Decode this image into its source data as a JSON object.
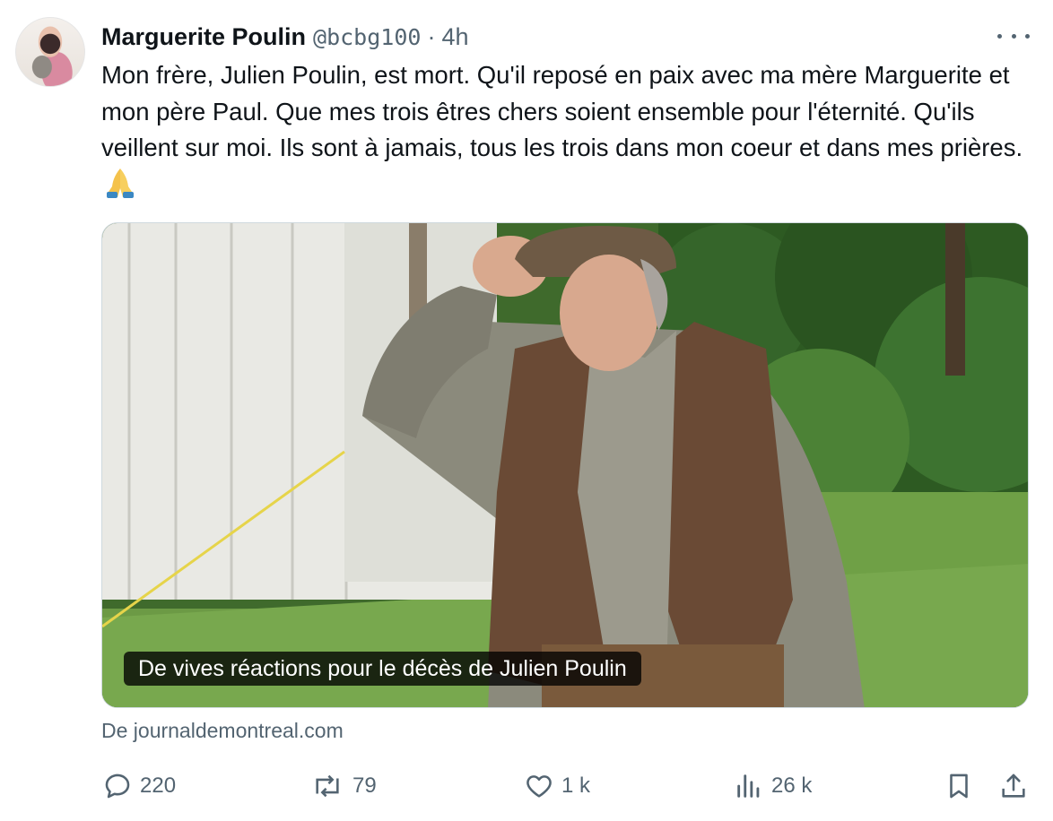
{
  "author": {
    "name": "Marguerite Poulin",
    "handle": "@bcbg100",
    "separator": "·",
    "time": "4h"
  },
  "tweet": {
    "text": "Mon frère, Julien Poulin, est mort. Qu'il reposé en paix avec ma mère Marguerite et mon père Paul. Que mes trois êtres chers soient ensemble pour l'éternité. Qu'ils veillent sur moi. Ils sont à jamais, tous les trois dans mon coeur et dans mes prières.",
    "emoji": "🙏"
  },
  "card": {
    "caption": "De vives réactions pour le décès de Julien Poulin",
    "source": "De journaldemontreal.com"
  },
  "actions": {
    "replies": "220",
    "reposts": "79",
    "likes": "1 k",
    "views": "26 k"
  },
  "icons": {
    "more": "more-horizontal-icon",
    "reply": "reply-icon",
    "repost": "repost-icon",
    "like": "heart-icon",
    "views": "views-bar-chart-icon",
    "bookmark": "bookmark-icon",
    "share": "share-icon"
  },
  "colors": {
    "text": "#0f1419",
    "secondary": "#536471",
    "border": "#cfd9de"
  }
}
